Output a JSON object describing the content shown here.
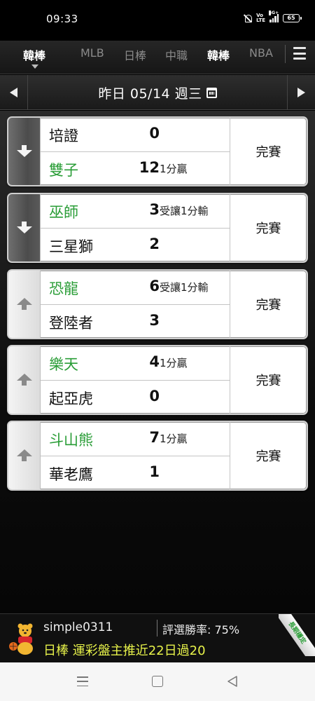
{
  "status_bar": {
    "time": "09:33",
    "network_label": "4G+",
    "battery": "65",
    "icons": [
      "bell-off-icon",
      "volte-icon",
      "signal-icon",
      "battery-icon"
    ]
  },
  "league_tabs": {
    "active": "韓棒",
    "items": [
      {
        "label": "韓棒",
        "active": true
      },
      {
        "label": "MLB",
        "active": false
      },
      {
        "label": "日棒",
        "active": false
      },
      {
        "label": "中職",
        "active": false
      },
      {
        "label": "韓棒",
        "active": false
      },
      {
        "label": "NBA",
        "active": false
      }
    ],
    "menu_icon": "hamburger-menu-icon"
  },
  "date_bar": {
    "label": "昨日 05/14 週三",
    "prev_icon": "triangle-left-icon",
    "next_icon": "triangle-right-icon",
    "calendar_icon": "calendar-icon"
  },
  "games": [
    {
      "arrow": "down",
      "home": {
        "name": "培證",
        "score": "0",
        "note": "",
        "winner": false
      },
      "away": {
        "name": "雙子",
        "score": "12",
        "note": "1分贏",
        "winner": true
      },
      "status": "完賽"
    },
    {
      "arrow": "down",
      "home": {
        "name": "巫師",
        "score": "3",
        "note": "受讓1分輸",
        "winner": true
      },
      "away": {
        "name": "三星獅",
        "score": "2",
        "note": "",
        "winner": false
      },
      "status": "完賽"
    },
    {
      "arrow": "up",
      "home": {
        "name": "恐龍",
        "score": "6",
        "note": "受讓1分輸",
        "winner": true
      },
      "away": {
        "name": "登陸者",
        "score": "3",
        "note": "",
        "winner": false
      },
      "status": "完賽"
    },
    {
      "arrow": "up",
      "home": {
        "name": "樂天",
        "score": "4",
        "note": "1分贏",
        "winner": true
      },
      "away": {
        "name": "起亞虎",
        "score": "0",
        "note": "",
        "winner": false
      },
      "status": "完賽"
    },
    {
      "arrow": "up",
      "home": {
        "name": "斗山熊",
        "score": "7",
        "note": "1分贏",
        "winner": true
      },
      "away": {
        "name": "華老鷹",
        "score": "1",
        "note": "",
        "winner": false
      },
      "status": "完賽"
    }
  ],
  "ad_banner": {
    "username": "simple0311",
    "win_rate": "評選勝率: 75%",
    "pick": "日棒 運彩盤主推近22日過20",
    "ribbon": "長期穩定",
    "mascot_icon": "pooh-mascot-icon"
  },
  "system_nav": {
    "icons": [
      "recent-apps-icon",
      "home-icon",
      "back-icon"
    ]
  },
  "colors": {
    "winner_green": "#2a9d37",
    "pick_yellow": "#e7f24a",
    "background": "#000000"
  }
}
